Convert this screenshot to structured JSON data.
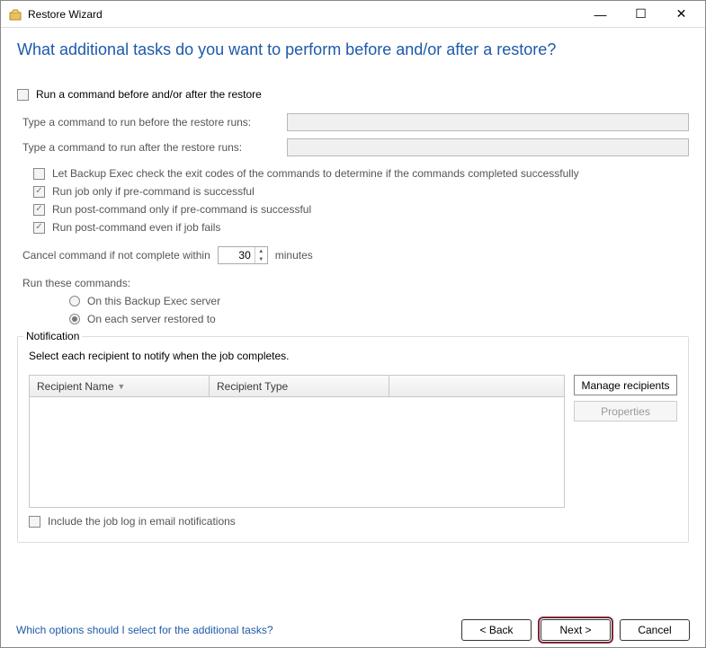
{
  "window": {
    "title": "Restore Wizard"
  },
  "page": {
    "heading": "What additional tasks do you want to perform before and/or after a restore?"
  },
  "tasks": {
    "run_command_label": "Run a command before and/or after the restore",
    "before_label": "Type a command to run before the restore runs:",
    "before_value": "",
    "after_label": "Type a command to run after the restore runs:",
    "after_value": "",
    "check_exit_label": "Let Backup Exec check the exit codes of the commands to determine if the commands completed successfully",
    "pre_success_label": "Run job only if pre-command is successful",
    "post_if_pre_label": "Run post-command only if pre-command is successful",
    "post_even_fail_label": "Run post-command even if job fails",
    "timeout_label_left": "Cancel command if not complete within",
    "timeout_value": "30",
    "timeout_label_right": "minutes",
    "run_these_label": "Run these commands:",
    "radio_server": "On this Backup Exec server",
    "radio_each": "On each server restored to"
  },
  "notification": {
    "legend": "Notification",
    "help": "Select each recipient to notify when the job completes.",
    "col_name": "Recipient Name",
    "col_type": "Recipient Type",
    "manage_btn": "Manage recipients",
    "properties_btn": "Properties",
    "include_log_label": "Include the job log in email notifications"
  },
  "footer": {
    "help_link": "Which options should I select for the additional tasks?",
    "back": "< Back",
    "next": "Next >",
    "cancel": "Cancel"
  }
}
